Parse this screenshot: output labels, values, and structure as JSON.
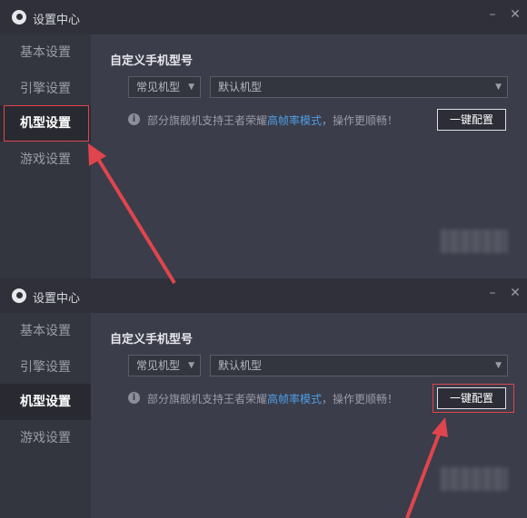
{
  "window_title": "设置中心",
  "controls": {
    "minimize": "–",
    "close": "✕"
  },
  "sidebar": {
    "items": [
      {
        "label": "基本设置"
      },
      {
        "label": "引擎设置"
      },
      {
        "label": "机型设置"
      },
      {
        "label": "游戏设置"
      }
    ],
    "active_index": 2
  },
  "content": {
    "section_title": "自定义手机型号",
    "type_select": {
      "value": "常见机型"
    },
    "model_select": {
      "value": "默认机型"
    },
    "info_icon_glyph": "i",
    "tip": {
      "prefix": "部分旗舰机支持王者荣耀",
      "link": "高帧率模式",
      "suffix": "，操作更顺畅！"
    },
    "one_click_button": "一键配置"
  },
  "colors": {
    "accent_link": "#4f9ee6",
    "highlight": "#e0454d",
    "background": "#3b3d4a"
  },
  "icons": [
    "app-logo-icon",
    "info-icon",
    "chevron-down-icon",
    "minimize-icon",
    "close-icon",
    "annotation-arrow-icon"
  ]
}
